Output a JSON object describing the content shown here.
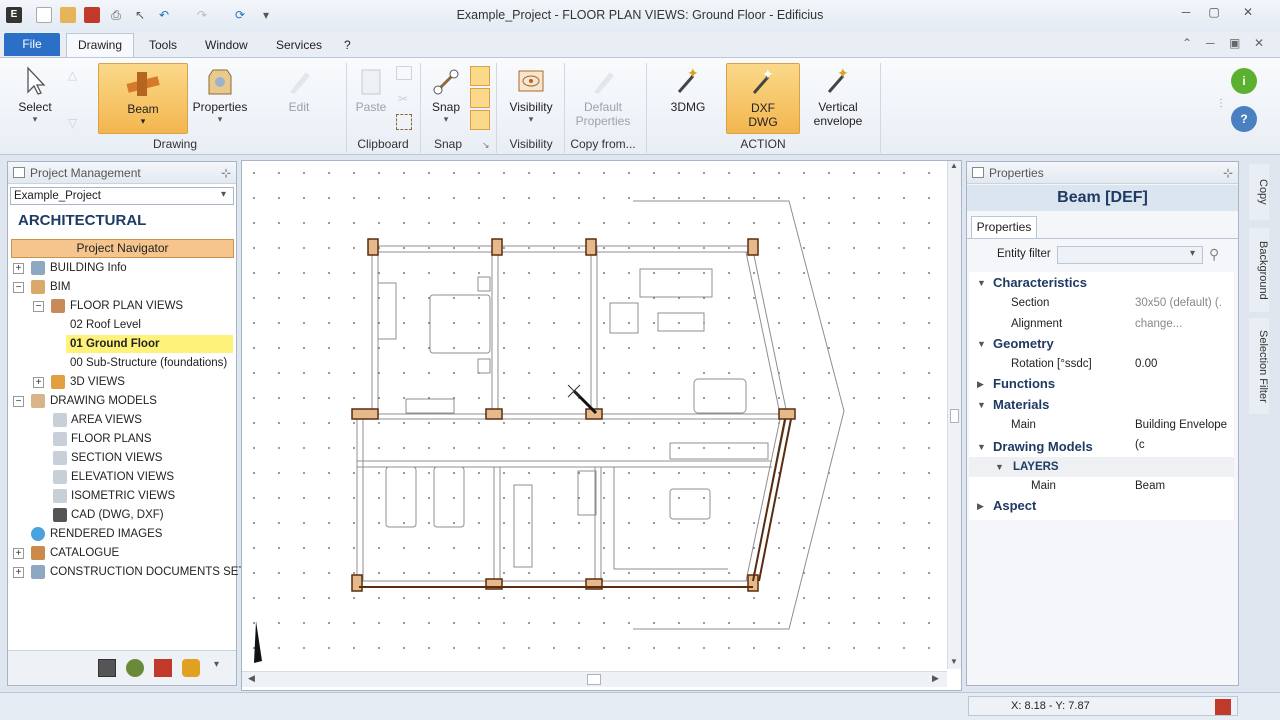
{
  "window": {
    "title": "Example_Project -  FLOOR PLAN VIEWS: Ground Floor - Edificius"
  },
  "menu": {
    "file": "File",
    "drawing": "Drawing",
    "tools": "Tools",
    "window": "Window",
    "services": "Services",
    "help": "?"
  },
  "ribbon": {
    "select": "Select",
    "beam": "Beam",
    "properties": "Properties",
    "edit": "Edit",
    "paste": "Paste",
    "snap": "Snap",
    "visibility": "Visibility",
    "default_properties_1": "Default",
    "default_properties_2": "Properties",
    "threedmg": "3DMG",
    "dxf_1": "DXF",
    "dxf_2": "DWG",
    "vertical_1": "Vertical",
    "vertical_2": "envelope",
    "groups": {
      "drawing": "Drawing",
      "clipboard": "Clipboard",
      "snap": "Snap",
      "visibility": "Visibility",
      "copy_from": "Copy from...",
      "action": "ACTION"
    }
  },
  "project_panel": {
    "title": "Project Management",
    "project_select": "Example_Project",
    "section": "ARCHITECTURAL",
    "navigator": "Project Navigator",
    "tree": {
      "building_info": "BUILDING Info",
      "bim": "BIM",
      "floor_plan_views": "FLOOR PLAN VIEWS",
      "roof_level": "02 Roof Level",
      "ground_floor": "01 Ground Floor",
      "substructure": "00 Sub-Structure (foundations)",
      "views_3d": "3D VIEWS",
      "drawing_models": "DRAWING MODELS",
      "area_views": "AREA VIEWS",
      "floor_plans": "FLOOR PLANS",
      "section_views": "SECTION VIEWS",
      "elevation_views": "ELEVATION VIEWS",
      "isometric_views": "ISOMETRIC VIEWS",
      "cad": "CAD (DWG, DXF)",
      "rendered_images": "RENDERED IMAGES",
      "catalogue": "CATALOGUE",
      "construction_docs": "CONSTRUCTION DOCUMENTS SET"
    }
  },
  "properties_panel": {
    "title": "Properties",
    "header": "Beam [DEF]",
    "tab": "Properties",
    "entity_filter": "Entity filter",
    "characteristics": "Characteristics",
    "section_label": "Section",
    "section_value": "30x50 (default)  (.",
    "alignment_label": "Alignment",
    "alignment_value": "change...",
    "geometry": "Geometry",
    "rotation_label": "Rotation [°ssdc]",
    "rotation_value": "0.00",
    "functions": "Functions",
    "materials": "Materials",
    "main_label": "Main",
    "main_value": "Building Envelope (c",
    "drawing_models": "Drawing Models",
    "layers": "LAYERS",
    "layer_main_label": "Main",
    "layer_main_value": "Beam",
    "aspect": "Aspect"
  },
  "side_tabs": {
    "copy": "Copy",
    "background": "Background",
    "selection_filter": "Selection Filter"
  },
  "status": {
    "coords": "X: 8.18 - Y: 7.87"
  }
}
